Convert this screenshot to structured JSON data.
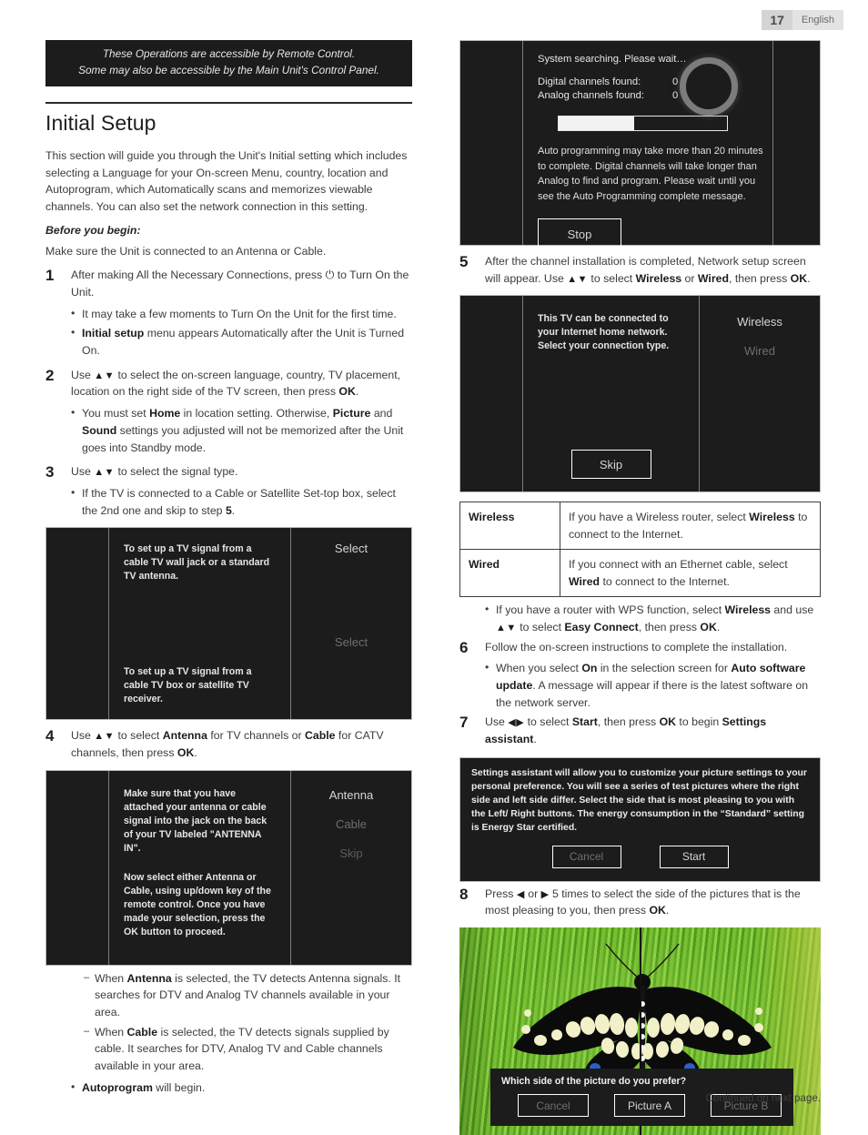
{
  "header": {
    "page_number": "17",
    "language": "English"
  },
  "banner": {
    "line1": "These Operations are accessible by Remote Control.",
    "line2": "Some may also be accessible by the Main Unit's Control Panel."
  },
  "section": {
    "title": "Initial Setup",
    "intro": "This section will guide you through the Unit's Initial setting which includes selecting a Language for your On-screen Menu, country, location and Autoprogram, which Automatically scans and memorizes viewable channels. You can also set the network connection in this setting.",
    "before_heading": "Before you begin:",
    "before_text": "Make sure the Unit is connected to an Antenna or Cable."
  },
  "steps": {
    "s1": {
      "num": "1",
      "text_a": "After making All the Necessary Connections, press ",
      "power_icon": "⏻",
      "text_b": " to Turn On the Unit.",
      "bullets": [
        "It may take a few moments to Turn On the Unit for the first time.",
        "Initial setup menu appears Automatically after the Unit is Turned On."
      ],
      "bullet2_bold": "Initial setup",
      "bullet2_rest": " menu appears Automatically after the Unit is Turned On."
    },
    "s2": {
      "num": "2",
      "text_a": "Use ",
      "arrows": "▲▼",
      "text_b": " to select the on-screen language, country, TV placement, location on the right side of the TV screen, then press ",
      "ok": "OK",
      "text_c": ".",
      "bullet_a": "You must set ",
      "bullet_home": "Home",
      "bullet_b": " in location setting. Otherwise, ",
      "bullet_picture": "Picture",
      "bullet_c": " and ",
      "bullet_sound": "Sound",
      "bullet_d": " settings you adjusted will not be memorized after the Unit goes into Standby mode."
    },
    "s3": {
      "num": "3",
      "text_a": "Use ",
      "arrows": "▲▼",
      "text_b": " to select the signal type.",
      "bullet_a": "If the TV is connected to a Cable or Satellite Set-top box, select the 2nd one and skip to step ",
      "bullet_step": "5",
      "bullet_b": "."
    },
    "s4": {
      "num": "4",
      "text_a": "Use ",
      "arrows": "▲▼",
      "text_b": " to select ",
      "antenna": "Antenna",
      "text_c": " for TV channels or ",
      "cable": "Cable",
      "text_d": " for CATV channels, then press ",
      "ok": "OK",
      "text_e": ".",
      "notes": [
        {
          "pre": "When ",
          "bold": "Antenna",
          "post": " is selected, the TV detects Antenna signals. It searches for DTV and Analog TV channels available in your area."
        },
        {
          "pre": "When ",
          "bold": "Cable",
          "post": " is selected, the TV detects signals supplied by cable. It searches for DTV, Analog TV and Cable channels available in your area."
        }
      ],
      "autoprogram_bold": "Autoprogram",
      "autoprogram_rest": " will begin."
    },
    "s5": {
      "num": "5",
      "text_a": "After the channel installation is completed, Network setup screen will appear. Use ",
      "arrows": "▲▼",
      "text_b": " to select ",
      "wireless": "Wireless",
      "text_c": " or ",
      "wired": "Wired",
      "text_d": ", then press ",
      "ok": "OK",
      "text_e": "."
    },
    "s6": {
      "num": "6",
      "text": "Follow the on-screen instructions to complete the installation.",
      "wps_bullet_a": "If you have a router with WPS function, select ",
      "wps_wireless": "Wireless",
      "wps_bullet_b": " and use ",
      "wps_arrows": "▲▼",
      "wps_bullet_c": " to select ",
      "wps_easy": "Easy Connect",
      "wps_bullet_d": ", then press ",
      "wps_ok": "OK",
      "wps_bullet_e": ".",
      "auto_bullet_a": "When you select ",
      "auto_on": "On",
      "auto_bullet_b": " in the selection screen for ",
      "auto_sw": "Auto software update",
      "auto_bullet_c": ". A message will appear if there is the latest software on the network server."
    },
    "s7": {
      "num": "7",
      "text_a": "Use ",
      "arrows": "◀▶",
      "text_b": " to select ",
      "start": "Start",
      "text_c": ", then press ",
      "ok": "OK",
      "text_d": " to begin ",
      "settings_assistant": "Settings assistant",
      "text_e": "."
    },
    "s8": {
      "num": "8",
      "text_a": "Press ",
      "left_arrow": "◀",
      "text_b": " or ",
      "right_arrow": "▶",
      "text_c": " 5 times to select the side of the pictures that is the most pleasing to you, then press ",
      "ok": "OK",
      "text_d": "."
    }
  },
  "screens": {
    "signal_type": {
      "option1_text": "To set up a TV signal from a cable TV wall jack or a standard TV antenna.",
      "option2_text": "To set up a TV signal from a cable TV box or satellite TV receiver.",
      "select1": "Select",
      "select2": "Select"
    },
    "antenna_cable": {
      "text1": "Make sure that you have attached your antenna or cable signal into the jack on the back of your TV labeled \"ANTENNA IN\".",
      "text2": "Now select either Antenna or Cable, using up/down key of the remote control. Once you have made your selection, press the OK button to proceed.",
      "options": [
        "Antenna",
        "Cable",
        "Skip"
      ]
    },
    "searching": {
      "status": "System searching. Please wait…",
      "digital_label": "Digital channels found:",
      "digital_value": "0",
      "analog_label": "Analog channels found:",
      "analog_value": "0",
      "progress_percent": 45,
      "note": "Auto programming may take more than 20 minutes to complete. Digital channels will take longer than Analog to find and program. Please wait until you see the Auto Programming complete message.",
      "stop_button": "Stop"
    },
    "network_setup": {
      "text": "This TV can be connected to your Internet home network. Select your connection type.",
      "options": [
        "Wireless",
        "Wired"
      ],
      "skip_button": "Skip"
    },
    "settings_assistant": {
      "text": "Settings assistant will allow you to customize your picture settings to your personal preference. You will see a series of test pictures where the right side and left side differ. Select the side that is most pleasing to you with the Left/ Right buttons. The energy consumption in the “Standard” setting is Energy Star certified.",
      "cancel_button": "Cancel",
      "start_button": "Start"
    },
    "picture_choice": {
      "question": "Which side of the picture do you prefer?",
      "cancel_button": "Cancel",
      "picture_a_button": "Picture A",
      "picture_b_button": "Picture B"
    }
  },
  "info_table": {
    "rows": [
      {
        "key": "Wireless",
        "pre": "If you have a Wireless router, select ",
        "bold": "Wireless",
        "post": " to connect to the Internet."
      },
      {
        "key": "Wired",
        "pre": "If you connect with an Ethernet cable, select ",
        "bold": "Wired",
        "post": " to connect to the Internet."
      }
    ]
  },
  "footer": {
    "continued": "Continued on next page."
  }
}
